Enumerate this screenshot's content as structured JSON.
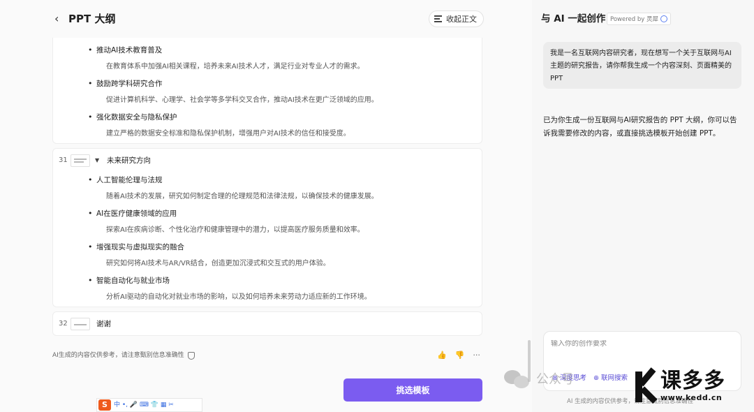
{
  "header": {
    "back_icon": "chevron-left-icon",
    "title": "PPT 大纲",
    "collapse_label": "收起正文"
  },
  "outline": {
    "card1_items": [
      {
        "title": "推动AI技术教育普及",
        "desc": "在教育体系中加强AI相关课程，培养未来AI技术人才，满足行业对专业人才的需求。"
      },
      {
        "title": "鼓励跨学科研究合作",
        "desc": "促进计算机科学、心理学、社会学等多学科交叉合作，推动AI技术在更广泛领域的应用。"
      },
      {
        "title": "强化数据安全与隐私保护",
        "desc": "建立严格的数据安全标准和隐私保护机制，增强用户对AI技术的信任和接受度。"
      }
    ],
    "slide31": {
      "number": "31",
      "title": "未来研究方向",
      "items": [
        {
          "title": "人工智能伦理与法规",
          "desc": "随着AI技术的发展，研究如何制定合理的伦理规范和法律法规，以确保技术的健康发展。"
        },
        {
          "title": "AI在医疗健康领域的应用",
          "desc": "探索AI在疾病诊断、个性化治疗和健康管理中的潜力，以提高医疗服务质量和效率。"
        },
        {
          "title": "增强现实与虚拟现实的融合",
          "desc": "研究如何将AI技术与AR/VR结合，创造更加沉浸式和交互式的用户体验。"
        },
        {
          "title": "智能自动化与就业市场",
          "desc": "分析AI驱动的自动化对就业市场的影响，以及如何培养未来劳动力适应新的工作环境。"
        }
      ]
    },
    "slide32": {
      "number": "32",
      "title": "谢谢"
    }
  },
  "footer": {
    "note": "AI生成的内容仅供参考，请注意甄别信息准确性",
    "thumbs_up": "👍",
    "thumbs_down": "👎",
    "more": "···",
    "pick_template": "挑选模板"
  },
  "ime": {
    "logo": "S",
    "label": "中 •, 🎤 ⌨ 👕 ▦ ✂"
  },
  "chat": {
    "title": "与 AI 一起创作",
    "powered_by": "Powered by 灵犀",
    "user_message": "我是一名互联网内容研究者，现在想写一个关于互联网与AI主题的研究报告，请你帮我生成一个内容深刻、页面精美的PPT",
    "ai_message": "已为你生成一份互联网与AI研究报告的 PPT 大纲，你可以告诉我需要修改的内容，或直接挑选模板开始创建 PPT。",
    "input_placeholder": "输入你的创作要求",
    "chip1": "⊗ 深度思考",
    "chip2": "⊕ 联网搜索",
    "disclaimer": "AI 生成的内容仅供参考，请注意甄别信息准确性"
  },
  "watermark": {
    "wechat_text": "公众号 ·",
    "brand": "课多多",
    "url": "www.kedd.cn"
  }
}
